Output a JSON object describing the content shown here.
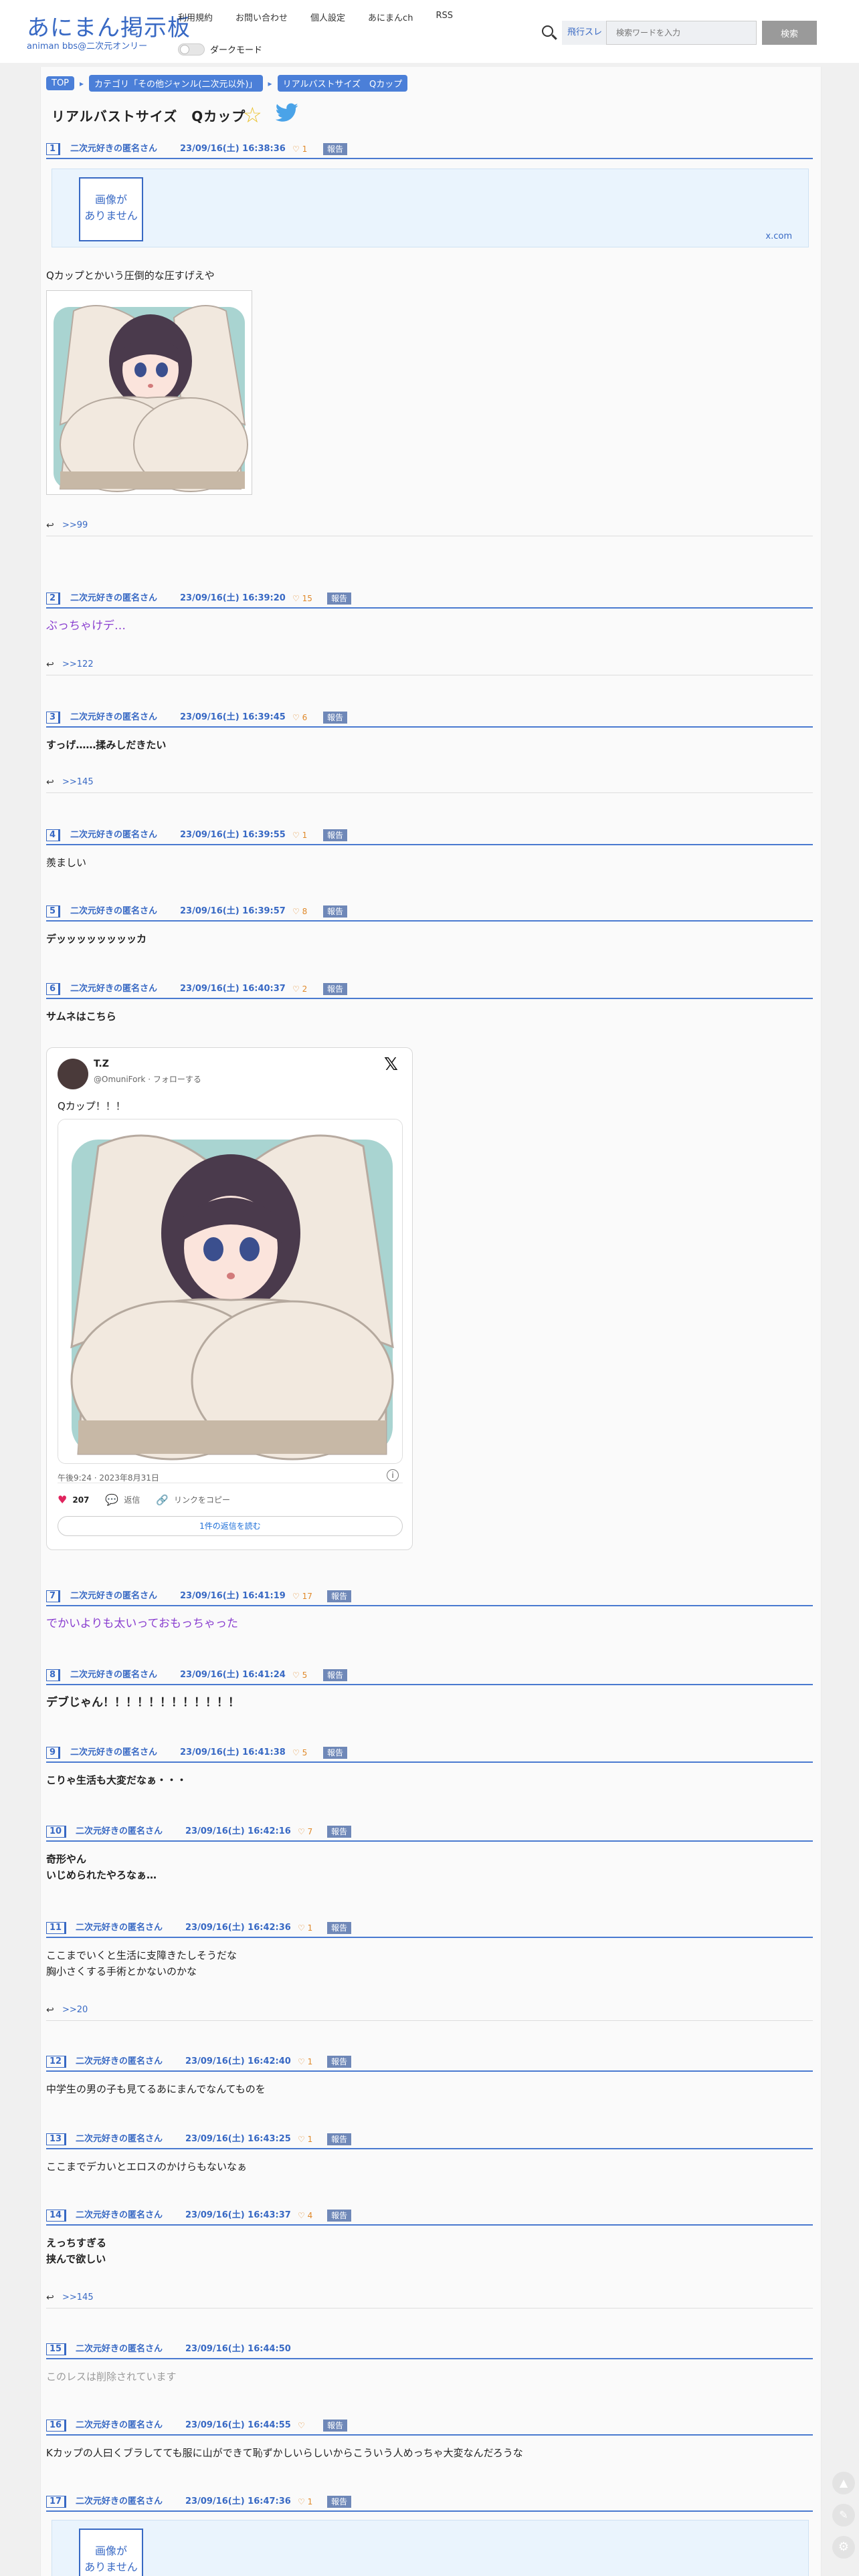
{
  "site": {
    "logo": "あにまん掲示板",
    "logo_sub": "animan bbs@二次元オンリー"
  },
  "nav": [
    "利用規約",
    "お問い合わせ",
    "個人設定",
    "あにまんch",
    "RSS"
  ],
  "dark_mode_label": "ダークモード",
  "search": {
    "scope": "飛行スレ",
    "placeholder": "検索ワードを入力",
    "button": "検索"
  },
  "breadcrumb": [
    "TOP",
    "カテゴリ「その他ジャンル(二次元以外)」",
    "リアルバストサイズ　Qカップ"
  ],
  "thread_title": "リアルバストサイズ　Qカップ",
  "no_image_text": "画像が\nありません",
  "xcom": "x.com",
  "posts": [
    {
      "num": "1",
      "name": "二次元好きの匿名さん",
      "date": "23/09/16(土) 16:38:36",
      "likes": "1",
      "report": "報告",
      "body": "Qカップとかいう圧倒的な圧すげえや",
      "reply": ">>99"
    },
    {
      "num": "2",
      "name": "二次元好きの匿名さん",
      "date": "23/09/16(土) 16:39:20",
      "likes": "15",
      "report": "報告",
      "body": "ぶっちゃけデ…",
      "reply": ">>122"
    },
    {
      "num": "3",
      "name": "二次元好きの匿名さん",
      "date": "23/09/16(土) 16:39:45",
      "likes": "6",
      "report": "報告",
      "body": "すっげ……揉みしだきたい",
      "reply": ">>145"
    },
    {
      "num": "4",
      "name": "二次元好きの匿名さん",
      "date": "23/09/16(土) 16:39:55",
      "likes": "1",
      "report": "報告",
      "body": "羨ましい"
    },
    {
      "num": "5",
      "name": "二次元好きの匿名さん",
      "date": "23/09/16(土) 16:39:57",
      "likes": "8",
      "report": "報告",
      "body": "デッッッッッッッッカ"
    },
    {
      "num": "6",
      "name": "二次元好きの匿名さん",
      "date": "23/09/16(土) 16:40:37",
      "likes": "2",
      "report": "報告",
      "body": "サムネはこちら"
    },
    {
      "num": "7",
      "name": "二次元好きの匿名さん",
      "date": "23/09/16(土) 16:41:19",
      "likes": "17",
      "report": "報告",
      "body": "でかいよりも太いっておもっちゃった"
    },
    {
      "num": "8",
      "name": "二次元好きの匿名さん",
      "date": "23/09/16(土) 16:41:24",
      "likes": "5",
      "report": "報告",
      "body": "デブじゃん！！！！！！！！！！！！"
    },
    {
      "num": "9",
      "name": "二次元好きの匿名さん",
      "date": "23/09/16(土) 16:41:38",
      "likes": "5",
      "report": "報告",
      "body": "こりゃ生活も大変だなぁ・・・"
    },
    {
      "num": "10",
      "name": "二次元好きの匿名さん",
      "date": "23/09/16(土) 16:42:16",
      "likes": "7",
      "report": "報告",
      "body1": "奇形やん",
      "body2": "いじめられたやろなぁ…"
    },
    {
      "num": "11",
      "name": "二次元好きの匿名さん",
      "date": "23/09/16(土) 16:42:36",
      "likes": "1",
      "report": "報告",
      "body1": "ここまでいくと生活に支障きたしそうだな",
      "body2": "胸小さくする手術とかないのかな",
      "reply": ">>20"
    },
    {
      "num": "12",
      "name": "二次元好きの匿名さん",
      "date": "23/09/16(土) 16:42:40",
      "likes": "1",
      "report": "報告",
      "body": "中学生の男の子も見てるあにまんでなんてものを"
    },
    {
      "num": "13",
      "name": "二次元好きの匿名さん",
      "date": "23/09/16(土) 16:43:25",
      "likes": "1",
      "report": "報告",
      "body": "ここまでデカいとエロスのかけらもないなぁ"
    },
    {
      "num": "14",
      "name": "二次元好きの匿名さん",
      "date": "23/09/16(土) 16:43:37",
      "likes": "4",
      "report": "報告",
      "body1": "えっちすぎる",
      "body2": "挟んで欲しい",
      "reply": ">>145"
    },
    {
      "num": "15",
      "name": "二次元好きの匿名さん",
      "date": "23/09/16(土) 16:44:50",
      "likes": "",
      "report": "",
      "body": "このレスは削除されています"
    },
    {
      "num": "16",
      "name": "二次元好きの匿名さん",
      "date": "23/09/16(土) 16:44:55",
      "likes": "",
      "report": "報告",
      "body": "Kカップの人曰くブラしてても服に山ができて恥ずかしいらしいからこういう人めっちゃ大変なんだろうな"
    },
    {
      "num": "17",
      "name": "二次元好きの匿名さん",
      "date": "23/09/16(土) 16:47:36",
      "likes": "1",
      "report": "報告"
    }
  ],
  "tweet": {
    "author": "T.Z",
    "handle": "@OmuniFork · フォローする",
    "text": "Qカップ！！！",
    "time": "午後9:24 · 2023年8月31日",
    "likes": "207",
    "reply_label": "返信",
    "copy_label": "リンクをコピー",
    "read_more": "1件の返信を読む"
  },
  "colors": {
    "accent": "#3869c4",
    "purple": "#8a3fd0",
    "like": "#e0892a"
  }
}
